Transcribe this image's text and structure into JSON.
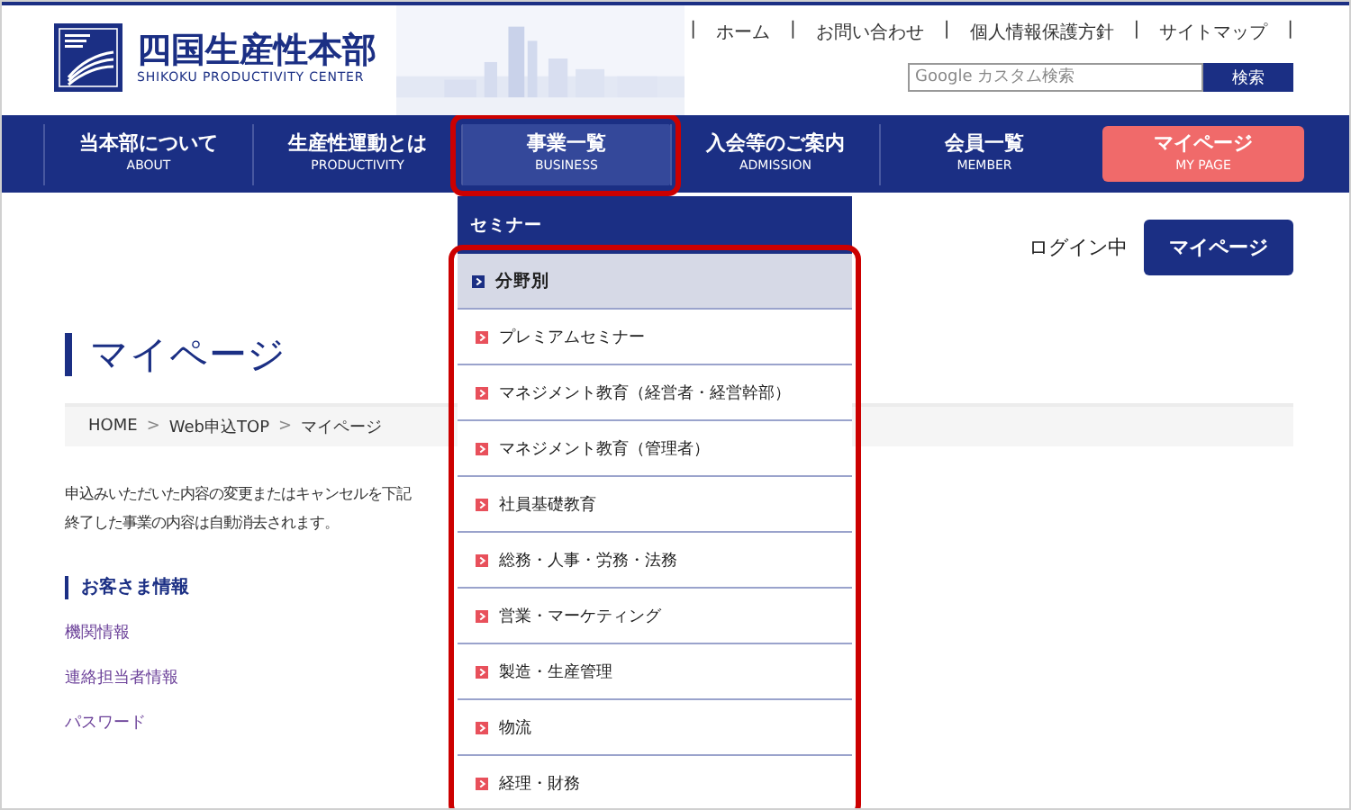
{
  "header": {
    "logo_name": "四国生産性本部",
    "logo_sub": "SHIKOKU PRODUCTIVITY CENTER",
    "link_separator": "|",
    "top_links": [
      "ホーム",
      "お問い合わせ",
      "個人情報保護方針",
      "サイトマップ"
    ],
    "search": {
      "placeholder": "Google カスタム検索",
      "button": "検索"
    }
  },
  "nav": {
    "items": [
      {
        "label": "当本部について",
        "sub": "ABOUT",
        "selected": false,
        "highlighted": false,
        "kind": "normal"
      },
      {
        "label": "生産性運動とは",
        "sub": "PRODUCTIVITY",
        "selected": false,
        "highlighted": false,
        "kind": "normal"
      },
      {
        "label": "事業一覧",
        "sub": "BUSINESS",
        "selected": true,
        "highlighted": true,
        "kind": "normal"
      },
      {
        "label": "入会等のご案内",
        "sub": "ADMISSION",
        "selected": false,
        "highlighted": false,
        "kind": "normal"
      },
      {
        "label": "会員一覧",
        "sub": "MEMBER",
        "selected": false,
        "highlighted": false,
        "kind": "normal"
      },
      {
        "label": "マイページ",
        "sub": "MY PAGE",
        "selected": false,
        "highlighted": false,
        "kind": "mypage"
      }
    ]
  },
  "dropdown": {
    "heading": "セミナー",
    "list_highlighted": true,
    "category": "分野別",
    "items": [
      "プレミアムセミナー",
      "マネジメント教育（経営者・経営幹部）",
      "マネジメント教育（管理者）",
      "社員基礎教育",
      "総務・人事・労務・法務",
      "営業・マーケティング",
      "製造・生産管理",
      "物流",
      "経理・財務"
    ]
  },
  "login": {
    "status": "ログイン中",
    "button": "マイページ"
  },
  "page_title": "マイページ",
  "breadcrumb": {
    "separator": ">",
    "items": [
      "HOME",
      "Web申込TOP",
      "マイページ"
    ]
  },
  "intro": [
    "申込みいただいた内容の変更またはキャンセルを下記",
    "終了した事業の内容は自動消去されます。"
  ],
  "section": {
    "heading": "お客さま情報",
    "links": [
      "機関情報",
      "連絡担当者情報",
      "パスワード"
    ]
  }
}
